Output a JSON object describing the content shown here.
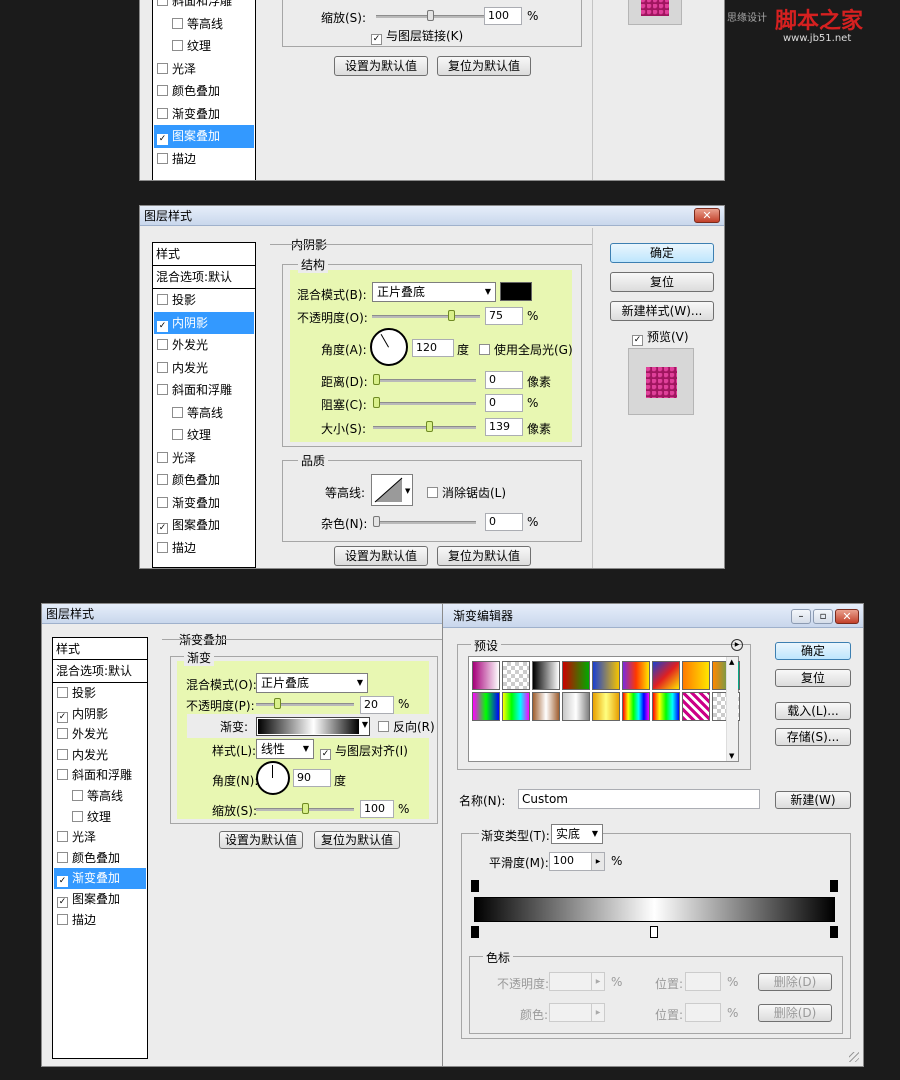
{
  "watermark": {
    "left": "思缘设计",
    "brand": "脚本之家",
    "site": "www.jb51.net"
  },
  "d1": {
    "items": [
      {
        "label": "斜面和浮雕",
        "checked": false,
        "sub": false
      },
      {
        "label": "等高线",
        "checked": false,
        "sub": true
      },
      {
        "label": "纹理",
        "checked": false,
        "sub": true
      },
      {
        "label": "光泽",
        "checked": false,
        "sub": false
      },
      {
        "label": "颜色叠加",
        "checked": false,
        "sub": false
      },
      {
        "label": "渐变叠加",
        "checked": false,
        "sub": false
      },
      {
        "label": "图案叠加",
        "checked": true,
        "sub": false,
        "selected": true
      },
      {
        "label": "描边",
        "checked": false,
        "sub": false
      }
    ],
    "scale_label": "缩放(S):",
    "scale_value": "100",
    "scale_unit": "%",
    "scale_pct": 0.5,
    "link_label": "与图层链接(K)",
    "link_checked": true,
    "btn_default": "设置为默认值",
    "btn_reset": "复位为默认值",
    "preview_color": "#a0155f"
  },
  "d2": {
    "title": "图层样式",
    "close": "✕",
    "styles_header": "样式",
    "blend_header": "混合选项:默认",
    "items": [
      {
        "label": "投影",
        "checked": false,
        "sub": false
      },
      {
        "label": "内阴影",
        "checked": true,
        "sub": false,
        "selected": true
      },
      {
        "label": "外发光",
        "checked": false,
        "sub": false
      },
      {
        "label": "内发光",
        "checked": false,
        "sub": false
      },
      {
        "label": "斜面和浮雕",
        "checked": false,
        "sub": false
      },
      {
        "label": "等高线",
        "checked": false,
        "sub": true
      },
      {
        "label": "纹理",
        "checked": false,
        "sub": true
      },
      {
        "label": "光泽",
        "checked": false,
        "sub": false
      },
      {
        "label": "颜色叠加",
        "checked": false,
        "sub": false
      },
      {
        "label": "渐变叠加",
        "checked": false,
        "sub": false
      },
      {
        "label": "图案叠加",
        "checked": true,
        "sub": false
      },
      {
        "label": "描边",
        "checked": false,
        "sub": false
      }
    ],
    "section_title": "内阴影",
    "structure_title": "结构",
    "blend_mode_label": "混合模式(B):",
    "blend_mode_value": "正片叠底",
    "shadow_color": "#000000",
    "opacity_label": "不透明度(O):",
    "opacity_value": "75",
    "opacity_pct": 0.75,
    "pct": "%",
    "angle_label": "角度(A):",
    "angle_value": "120",
    "angle_deg": 120,
    "degree_unit": "度",
    "global_light_label": "使用全局光(G)",
    "global_light_checked": false,
    "distance_label": "距离(D):",
    "distance_value": "0",
    "distance_pct": 0,
    "choke_label": "阻塞(C):",
    "choke_value": "0",
    "choke_pct": 0,
    "size_label": "大小(S):",
    "size_value": "139",
    "size_pct": 0.55,
    "pixel_unit": "像素",
    "quality_title": "品质",
    "contour_label": "等高线:",
    "antialias_label": "消除锯齿(L)",
    "antialias_checked": false,
    "noise_label": "杂色(N):",
    "noise_value": "0",
    "noise_pct": 0,
    "btn_default": "设置为默认值",
    "btn_reset": "复位为默认值",
    "ok": "确定",
    "reset": "复位",
    "new_style": "新建样式(W)...",
    "preview_label": "预览(V)",
    "preview_checked": true,
    "preview_color": "#a0155f",
    "highlight_color": "#e8f7b2"
  },
  "d3": {
    "title": "图层样式",
    "styles_header": "样式",
    "blend_header": "混合选项:默认",
    "items": [
      {
        "label": "投影",
        "checked": false,
        "sub": false
      },
      {
        "label": "内阴影",
        "checked": true,
        "sub": false
      },
      {
        "label": "外发光",
        "checked": false,
        "sub": false
      },
      {
        "label": "内发光",
        "checked": false,
        "sub": false
      },
      {
        "label": "斜面和浮雕",
        "checked": false,
        "sub": false
      },
      {
        "label": "等高线",
        "checked": false,
        "sub": true
      },
      {
        "label": "纹理",
        "checked": false,
        "sub": true
      },
      {
        "label": "光泽",
        "checked": false,
        "sub": false
      },
      {
        "label": "颜色叠加",
        "checked": false,
        "sub": false
      },
      {
        "label": "渐变叠加",
        "checked": true,
        "sub": false,
        "selected": true
      },
      {
        "label": "图案叠加",
        "checked": true,
        "sub": false
      },
      {
        "label": "描边",
        "checked": false,
        "sub": false
      }
    ],
    "section_title": "渐变叠加",
    "gradient_title": "渐变",
    "blend_mode_label": "混合模式(O):",
    "blend_mode_value": "正片叠底",
    "opacity_label": "不透明度(P):",
    "opacity_value": "20",
    "opacity_pct": 0.2,
    "pct": "%",
    "gradient_label": "渐变:",
    "reverse_label": "反向(R)",
    "reverse_checked": false,
    "style_label": "样式(L):",
    "style_value": "线性",
    "align_label": "与图层对齐(I)",
    "align_checked": true,
    "angle_label": "角度(N):",
    "angle_value": "90",
    "angle_deg": 90,
    "degree_unit": "度",
    "scale_label": "缩放(S):",
    "scale_value": "100",
    "scale_pct": 0.5,
    "btn_default": "设置为默认值",
    "btn_reset": "复位为默认值"
  },
  "d4": {
    "title": "渐变编辑器",
    "presets_label": "预设",
    "ok": "确定",
    "reset": "复位",
    "load": "载入(L)...",
    "save": "存储(S)...",
    "name_label": "名称(N):",
    "name_value": "Custom",
    "new_btn": "新建(W)",
    "type_label": "渐变类型(T):",
    "type_value": "实底",
    "smooth_label": "平滑度(M):",
    "smooth_value": "100",
    "pct": "%",
    "stops_title": "色标",
    "stop_opacity_label": "不透明度:",
    "stop_location_label": "位置:",
    "stop_delete": "删除(D)",
    "stop_color_label": "颜色:",
    "presets": [
      "linear-gradient(90deg,#a6007a,#ffffff)",
      "repeating-conic-gradient(#ccc 0 25%,#fff 0 50%) 0 0/8px 8px",
      "linear-gradient(90deg,#000,#fff)",
      "linear-gradient(90deg,#c00,#0a0)",
      "linear-gradient(90deg,#1a3fd1,#f5c400)",
      "linear-gradient(90deg,#7a2be0,#ff3700,#ffe600)",
      "linear-gradient(135deg,#1a3fd1,#e02020,#ffe600)",
      "linear-gradient(90deg,#ff7a00,#ffe600)",
      "linear-gradient(90deg,#f80,#0a8)",
      "linear-gradient(90deg,#f0f,#0f0,#00f)",
      "linear-gradient(90deg,#ff0,#0f0,#0ff,#f0f)",
      "linear-gradient(90deg,#a06030,#fff,#a06030)",
      "linear-gradient(90deg,#c8c8c8,#fff,#808080)",
      "linear-gradient(90deg,#e8a000,#ffff80,#e8a000)",
      "linear-gradient(90deg,#f00,#ff0,#0f0,#0ff,#00f,#f0f)",
      "linear-gradient(90deg,#f00,#ff0,#0f0,#0ff,#00f)",
      "repeating-linear-gradient(45deg,#c08,#c08 3px,#fff 3px,#fff 6px)",
      "repeating-conic-gradient(#ccc 0 25%,#fff 0 50%) 0 0/8px 8px"
    ]
  }
}
